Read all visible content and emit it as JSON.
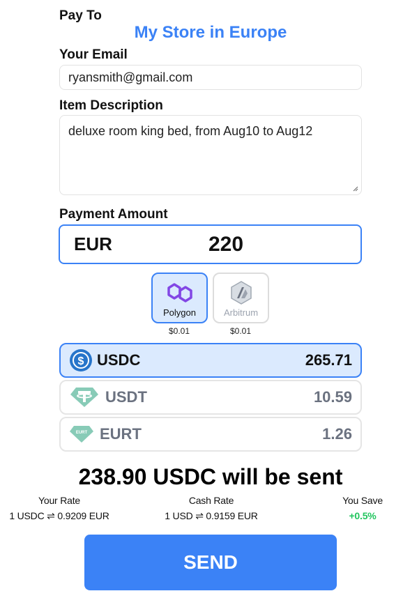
{
  "pay_to": {
    "label": "Pay To",
    "store_name": "My Store in Europe"
  },
  "email": {
    "label": "Your Email",
    "value": "ryansmith@gmail.com"
  },
  "description": {
    "label": "Item Description",
    "value": "deluxe room king bed, from Aug10 to Aug12"
  },
  "payment": {
    "label": "Payment Amount",
    "currency": "EUR",
    "amount": "220"
  },
  "chains": [
    {
      "name": "Polygon",
      "fee": "$0.01",
      "selected": true,
      "icon": "polygon-icon",
      "color": "#8247e5"
    },
    {
      "name": "Arbitrum",
      "fee": "$0.01",
      "selected": false,
      "icon": "arbitrum-icon",
      "color": "#9ca3af"
    }
  ],
  "tokens": [
    {
      "symbol": "USDC",
      "balance": "265.71",
      "selected": true,
      "icon": "usdc-icon",
      "color": "#2775ca"
    },
    {
      "symbol": "USDT",
      "balance": "10.59",
      "selected": false,
      "icon": "usdt-icon",
      "color": "#26a17b"
    },
    {
      "symbol": "EURT",
      "balance": "1.26",
      "selected": false,
      "icon": "eurt-icon",
      "color": "#26a17b"
    }
  ],
  "summary": "238.90 USDC will be sent",
  "rates": {
    "your_rate_label": "Your Rate",
    "your_rate_value": "1 USDC ⇌ 0.9209 EUR",
    "cash_rate_label": "Cash Rate",
    "cash_rate_value": "1 USD ⇌ 0.9159 EUR",
    "save_label": "You Save",
    "save_value": "+0.5%"
  },
  "send_label": "SEND",
  "colors": {
    "accent": "#3b82f6",
    "selected_bg": "#dbeafe",
    "positive": "#22c55e"
  }
}
